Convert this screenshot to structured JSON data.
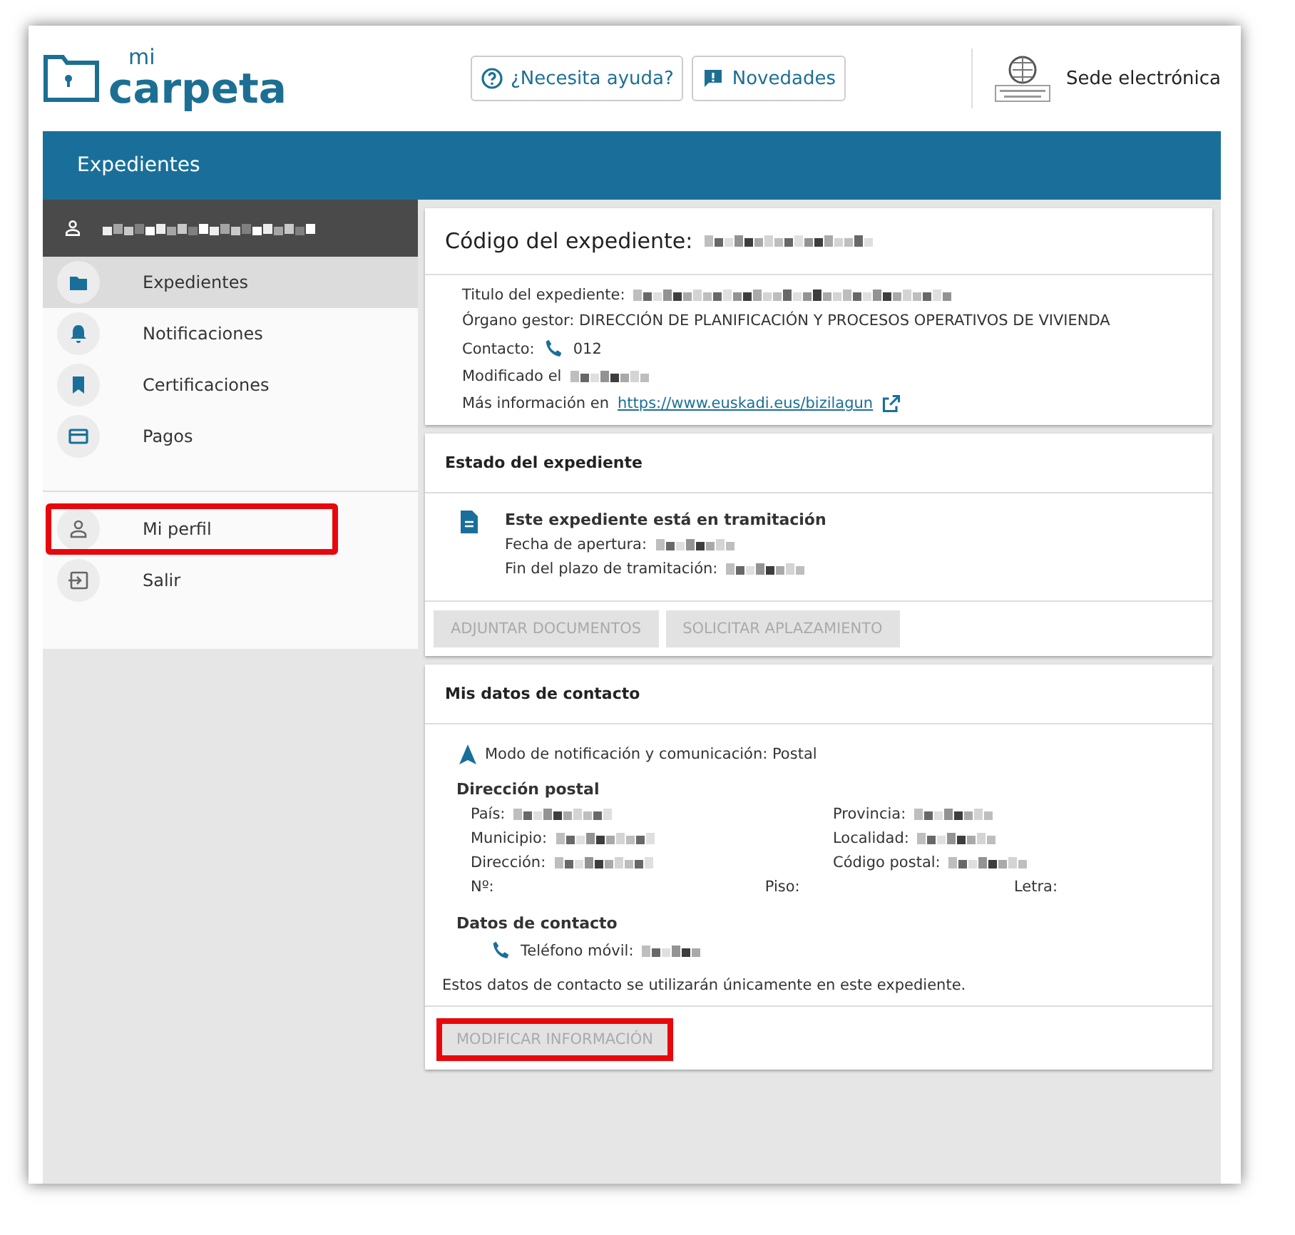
{
  "header": {
    "logo": {
      "small": "mi",
      "big": "carpeta"
    },
    "buttons": [
      {
        "label": "¿Necesita ayuda?",
        "kind": "help"
      },
      {
        "label": "Novedades",
        "kind": "news"
      }
    ],
    "sede": "Sede electrónica"
  },
  "banner": {
    "title": "Expedientes"
  },
  "sidebar": {
    "main_items": [
      {
        "label": "Expedientes",
        "kind": "folder",
        "selected": true,
        "highlighted": false
      },
      {
        "label": "Notificaciones",
        "kind": "bell",
        "selected": false,
        "highlighted": false
      },
      {
        "label": "Certificaciones",
        "kind": "bookmark",
        "selected": false,
        "highlighted": false
      },
      {
        "label": "Pagos",
        "kind": "card",
        "selected": false,
        "highlighted": false
      }
    ],
    "secondary_items": [
      {
        "label": "Mi perfil",
        "kind": "person",
        "selected": false,
        "highlighted": true
      },
      {
        "label": "Salir",
        "kind": "exit",
        "selected": false,
        "highlighted": false
      }
    ]
  },
  "expediente": {
    "code_label": "Código del expediente:",
    "title_label": "Titulo del expediente:",
    "organo": "Órgano gestor: DIRECCIÓN DE PLANIFICACIÓN Y PROCESOS OPERATIVOS DE VIVIENDA",
    "contact_label": "Contacto:",
    "contact_phone": "012",
    "modified_label": "Modificado el",
    "more_info_label": "Más información en",
    "more_info_link": "https://www.euskadi.eus/bizilagun"
  },
  "estado": {
    "title": "Estado del expediente",
    "status": "Este expediente está en tramitación",
    "apertura_label": "Fecha de apertura:",
    "plazo_label": "Fin del plazo de tramitación:",
    "buttons": [
      {
        "label": "ADJUNTAR DOCUMENTOS",
        "disabled": true,
        "highlighted": false
      },
      {
        "label": "SOLICITAR APLAZAMIENTO",
        "disabled": true,
        "highlighted": false
      }
    ]
  },
  "contacto": {
    "title": "Mis datos de contacto",
    "mode": "Modo de notificación y comunicación: Postal",
    "address_title": "Dirección postal",
    "address_rows": [
      [
        "País:",
        "Provincia:"
      ],
      [
        "Municipio:",
        "Localidad:"
      ],
      [
        "Dirección:",
        "Código postal:"
      ]
    ],
    "address_last": [
      "Nº:",
      "Piso:",
      "Letra:"
    ],
    "contact_title": "Datos de contacto",
    "phone_label": "Teléfono móvil:",
    "note": "Estos datos de contacto se utilizarán únicamente en este expediente.",
    "button": {
      "label": "MODIFICAR INFORMACIÓN",
      "disabled": true,
      "highlighted": true
    }
  }
}
